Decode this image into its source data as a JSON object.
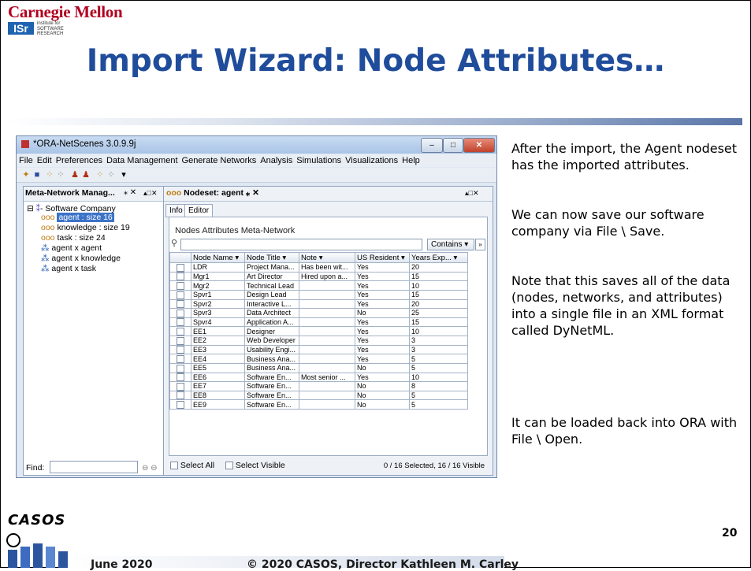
{
  "header": {
    "university": "Carnegie Mellon",
    "isr_logo": "ISr",
    "isr_subtitle": "institute for\nSOFTWARE\nRESEARCH",
    "title": "Import Wizard: Node Attributes…"
  },
  "window": {
    "title": "*ORA-NetScenes 3.0.9.9j",
    "menu": [
      "File",
      "Edit",
      "Preferences",
      "Data Management",
      "Generate Networks",
      "Analysis",
      "Simulations",
      "Visualizations",
      "Help"
    ],
    "left_tab": "Meta-Network Manag...",
    "right_tab": "Nodeset: agent",
    "tree": {
      "root": "Software Company",
      "items": [
        "agent : size 16",
        "knowledge : size 19",
        "task : size 24",
        "agent x agent",
        "agent x knowledge",
        "agent x task"
      ]
    },
    "find_label": "Find:",
    "subtabs": [
      "Info",
      "Editor"
    ],
    "inner_tabs": "Nodes  Attributes  Meta-Network",
    "contains_label": "Contains",
    "columns": [
      "Node Name",
      "Node Title",
      "Note",
      "US Resident",
      "Years Exp..."
    ],
    "rows": [
      [
        "LDR",
        "Project Mana...",
        "Has been wit...",
        "Yes",
        "20"
      ],
      [
        "Mgr1",
        "Art Director",
        "Hired upon a...",
        "Yes",
        "15"
      ],
      [
        "Mgr2",
        "Technical Lead",
        "",
        "Yes",
        "10"
      ],
      [
        "Spvr1",
        "Design Lead",
        "",
        "Yes",
        "15"
      ],
      [
        "Spvr2",
        "Interactive L...",
        "",
        "Yes",
        "20"
      ],
      [
        "Spvr3",
        "Data Architect",
        "",
        "No",
        "25"
      ],
      [
        "Spvr4",
        "Application A...",
        "",
        "Yes",
        "15"
      ],
      [
        "EE1",
        "Designer",
        "",
        "Yes",
        "10"
      ],
      [
        "EE2",
        "Web Developer",
        "",
        "Yes",
        "3"
      ],
      [
        "EE3",
        "Usability Engi...",
        "",
        "Yes",
        "3"
      ],
      [
        "EE4",
        "Business Ana...",
        "",
        "Yes",
        "5"
      ],
      [
        "EE5",
        "Business Ana...",
        "",
        "No",
        "5"
      ],
      [
        "EE6",
        "Software En...",
        "Most senior ...",
        "Yes",
        "10"
      ],
      [
        "EE7",
        "Software En...",
        "",
        "No",
        "8"
      ],
      [
        "EE8",
        "Software En...",
        "",
        "No",
        "5"
      ],
      [
        "EE9",
        "Software En...",
        "",
        "No",
        "5"
      ]
    ],
    "select_all": "Select All",
    "select_visible": "Select Visible",
    "status": "0 / 16 Selected, 16 / 16 Visible"
  },
  "side_text": [
    "After the import, the Agent nodeset has the imported attributes.",
    "We can now save our software company via File \\ Save.",
    "Note that this saves all of the data (nodes, networks, and attributes) into a single file in an XML format called DyNetML.",
    "It can be loaded back into ORA with File \\ Open."
  ],
  "footer": {
    "logo": "CASOS",
    "date": "June 2020",
    "copyright": "© 2020 CASOS, Director Kathleen M. Carley",
    "page": "20"
  }
}
